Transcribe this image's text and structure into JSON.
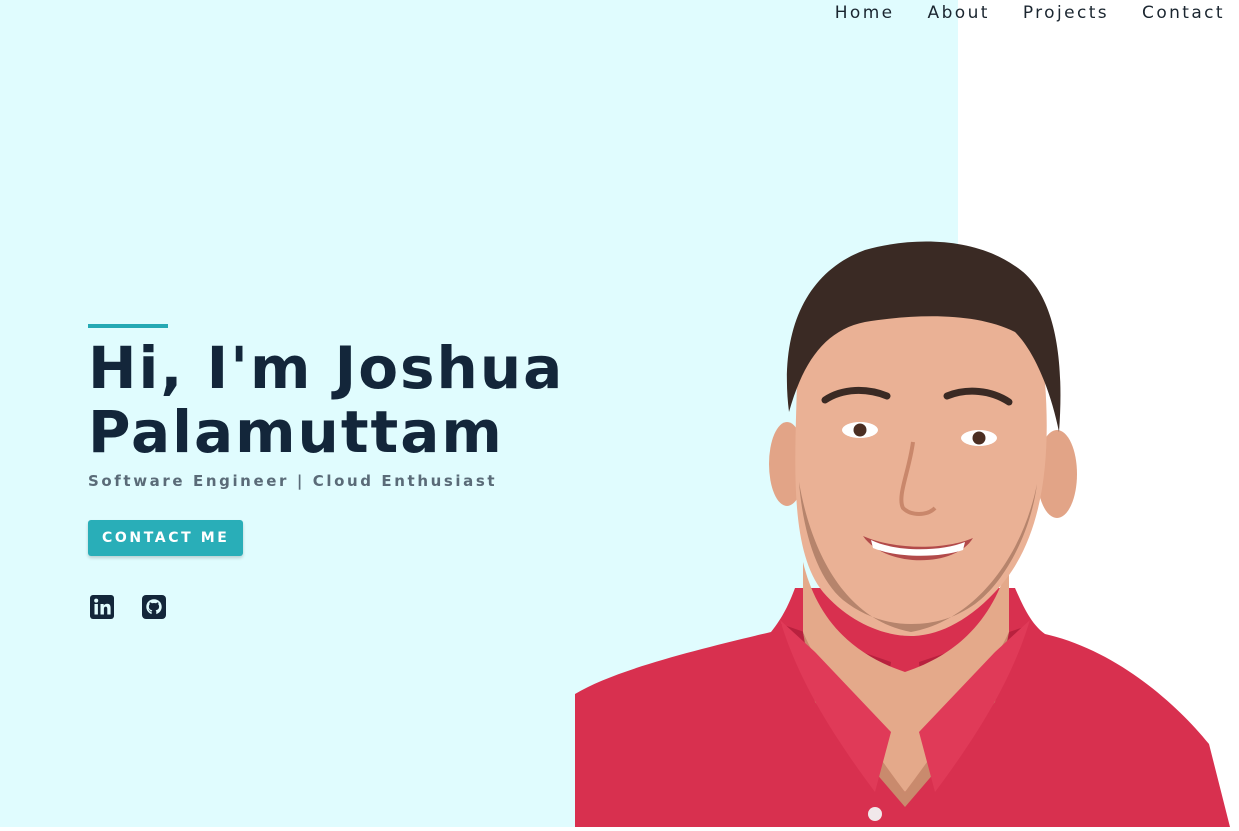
{
  "nav": {
    "items": [
      {
        "label": "Home"
      },
      {
        "label": "About"
      },
      {
        "label": "Projects"
      },
      {
        "label": "Contact"
      }
    ]
  },
  "hero": {
    "title_line1": "Hi, I'm Joshua",
    "title_line2": "Palamuttam",
    "subtitle": "Software Engineer | Cloud Enthusiast",
    "cta_label": "CONTACT ME",
    "socials": [
      {
        "icon": "linkedin-icon"
      },
      {
        "icon": "github-icon"
      }
    ]
  },
  "colors": {
    "page_left_bg": "#e0fcfe",
    "page_right_bg": "#ffffff",
    "accent": "#29aeb8",
    "heading": "#13263a",
    "subtitle": "#5a6b78",
    "shirt": "#d8304f"
  }
}
